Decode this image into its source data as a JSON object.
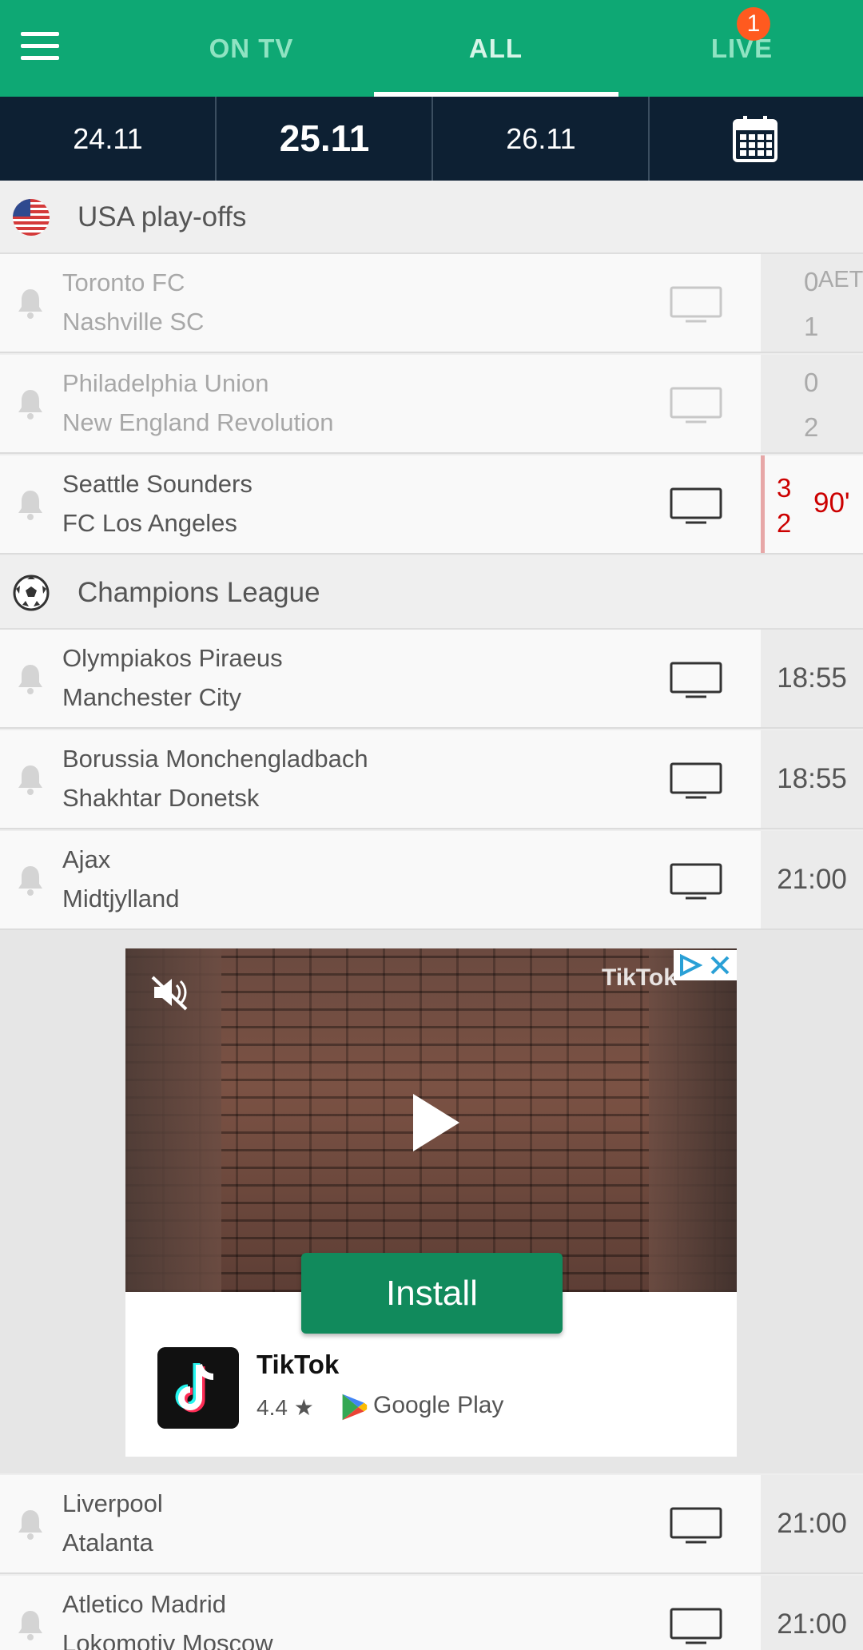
{
  "tabs": [
    "ON TV",
    "ALL",
    "LIVE"
  ],
  "live_badge": "1",
  "dates": [
    "24.11",
    "25.11",
    "26.11"
  ],
  "sections": [
    {
      "title": "USA play-offs",
      "matches": [
        {
          "home": "Toronto FC",
          "away": "Nashville SC",
          "score_home": "0",
          "score_away": "1",
          "note": "AET"
        },
        {
          "home": "Philadelphia Union",
          "away": "New England Revolution",
          "score_home": "0",
          "score_away": "2"
        },
        {
          "home": "Seattle Sounders",
          "away": "FC Los Angeles",
          "score_home": "3",
          "score_away": "2",
          "minute": "90'"
        }
      ]
    },
    {
      "title": "Champions League",
      "matches": [
        {
          "home": "Olympiakos Piraeus",
          "away": "Manchester City",
          "time": "18:55"
        },
        {
          "home": "Borussia Monchengladbach",
          "away": "Shakhtar Donetsk",
          "time": "18:55"
        },
        {
          "home": "Ajax",
          "away": "Midtjylland",
          "time": "21:00"
        },
        {
          "home": "Liverpool",
          "away": "Atalanta",
          "time": "21:00"
        },
        {
          "home": "Atletico Madrid",
          "away": "Lokomotiv Moscow",
          "time": "21:00"
        }
      ]
    }
  ],
  "ad": {
    "watermark": "TikTok",
    "install_label": "Install",
    "app_name": "TikTok",
    "rating": "4.4",
    "store": "Google Play"
  },
  "colors": {
    "brand": "#0ea874",
    "datebar": "#0d2033",
    "live": "#cc0000",
    "install": "#118a5c"
  }
}
